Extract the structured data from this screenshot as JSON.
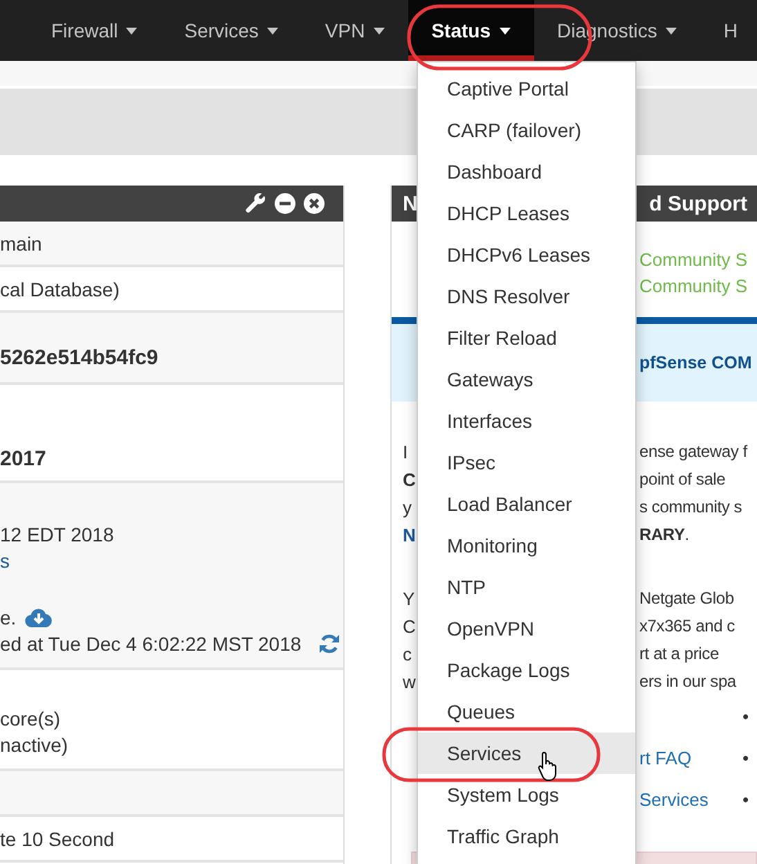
{
  "navbar": {
    "items": [
      {
        "label": "Firewall",
        "caret": true,
        "selected": false
      },
      {
        "label": "Services",
        "caret": true,
        "selected": false
      },
      {
        "label": "VPN",
        "caret": true,
        "selected": false
      },
      {
        "label": "Status",
        "caret": true,
        "selected": true
      },
      {
        "label": "Diagnostics",
        "caret": true,
        "selected": false
      },
      {
        "label": "H",
        "caret": false,
        "selected": false
      }
    ]
  },
  "status_menu": {
    "items": [
      {
        "label": "Captive Portal",
        "selected": false
      },
      {
        "label": "CARP (failover)",
        "selected": false
      },
      {
        "label": "Dashboard",
        "selected": false
      },
      {
        "label": "DHCP Leases",
        "selected": false
      },
      {
        "label": "DHCPv6 Leases",
        "selected": false
      },
      {
        "label": "DNS Resolver",
        "selected": false
      },
      {
        "label": "Filter Reload",
        "selected": false
      },
      {
        "label": "Gateways",
        "selected": false
      },
      {
        "label": "Interfaces",
        "selected": false
      },
      {
        "label": "IPsec",
        "selected": false
      },
      {
        "label": "Load Balancer",
        "selected": false
      },
      {
        "label": "Monitoring",
        "selected": false
      },
      {
        "label": "NTP",
        "selected": false
      },
      {
        "label": "OpenVPN",
        "selected": false
      },
      {
        "label": "Package Logs",
        "selected": false
      },
      {
        "label": "Queues",
        "selected": false
      },
      {
        "label": "Services",
        "selected": true
      },
      {
        "label": "System Logs",
        "selected": false
      },
      {
        "label": "Traffic Graph",
        "selected": false
      }
    ]
  },
  "left_panel": {
    "rows": [
      {
        "lines": [
          {
            "text": "main",
            "kind": "text"
          }
        ]
      },
      {
        "lines": [
          {
            "text": "cal Database)",
            "kind": "text"
          }
        ]
      },
      {
        "lines": [
          {
            "text": "5262e514b54fc9",
            "kind": "strong"
          }
        ]
      },
      {
        "lines": [
          {
            "text": "2017",
            "kind": "strong"
          }
        ]
      },
      {
        "lines": [
          {
            "text": "12 EDT 2018",
            "kind": "text"
          },
          {
            "text": "s",
            "kind": "link"
          },
          {
            "text": "e.",
            "kind": "download"
          },
          {
            "text": "ed at Tue Dec 4 6:02:22 MST 2018",
            "kind": "refresh"
          }
        ]
      },
      {
        "lines": [
          {
            "text": "core(s)",
            "kind": "text"
          },
          {
            "text": "nactive)",
            "kind": "text"
          }
        ]
      },
      {},
      {
        "lines": [
          {
            "text": "te 10 Second",
            "kind": "text"
          }
        ]
      }
    ]
  },
  "right_panel": {
    "title_start": "N",
    "title_end": "d Support",
    "links": [
      "Community S",
      "Community S"
    ],
    "notice": "pfSense COM",
    "paragraphs": [
      {
        "lines": [
          {
            "left": "I",
            "kind": "text",
            "right": "ense gateway f"
          },
          {
            "left": "C",
            "kind": "strong",
            "right": "point of sale"
          },
          {
            "left": "y",
            "kind": "text",
            "right": "s community s"
          },
          {
            "left": "N",
            "kind": "link",
            "right": "**RARY**."
          }
        ]
      },
      {
        "lines": [
          {
            "left": "Y",
            "kind": "text",
            "right": "Netgate Glob"
          },
          {
            "left": "C",
            "kind": "text",
            "right": "x7x365 and c"
          },
          {
            "left": "c",
            "kind": "text",
            "right": "rt at a price"
          },
          {
            "left": "w",
            "kind": "text",
            "right": "ers in our spa"
          }
        ]
      }
    ],
    "bullets": [
      {
        "bullet": "•"
      },
      {
        "link": "rt FAQ",
        "bullet": "•"
      },
      {
        "link": "Services",
        "bullet": "•"
      }
    ]
  }
}
